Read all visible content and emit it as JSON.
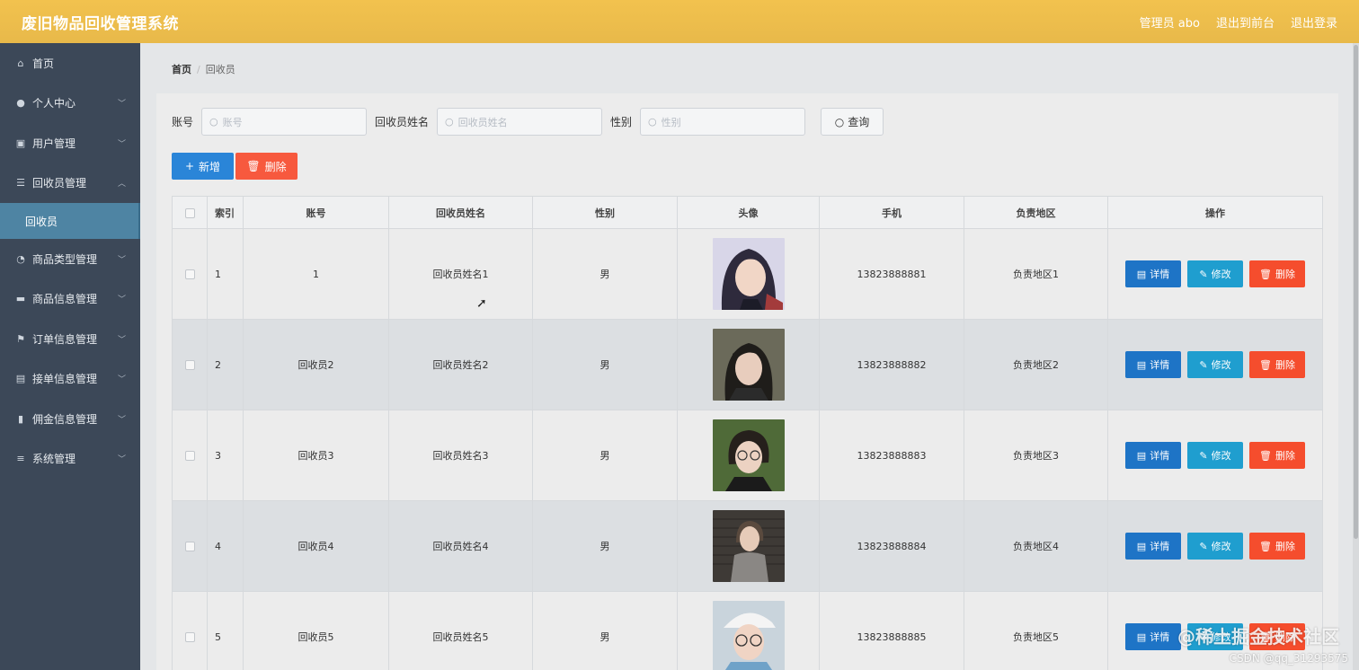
{
  "app": {
    "title": "废旧物品回收管理系统"
  },
  "topnav": {
    "admin": "管理员 abo",
    "exit_front": "退出到前台",
    "logout": "退出登录"
  },
  "sidebar": {
    "items": [
      {
        "label": "首页",
        "icon": "home-icon",
        "glyph": "⌂",
        "has_arrow": false
      },
      {
        "label": "个人中心",
        "icon": "user-icon",
        "glyph": "●",
        "has_arrow": true,
        "arrow": "﹀"
      },
      {
        "label": "用户管理",
        "icon": "clipboard-icon",
        "glyph": "▣",
        "has_arrow": true,
        "arrow": "﹀"
      },
      {
        "label": "回收员管理",
        "icon": "sliders-icon",
        "glyph": "☰",
        "has_arrow": true,
        "arrow": "︿"
      },
      {
        "label": "商品类型管理",
        "icon": "dashboard-icon",
        "glyph": "◔",
        "has_arrow": true,
        "arrow": "﹀"
      },
      {
        "label": "商品信息管理",
        "icon": "stamp-icon",
        "glyph": "▬",
        "has_arrow": true,
        "arrow": "﹀"
      },
      {
        "label": "订单信息管理",
        "icon": "flag-icon",
        "glyph": "⚑",
        "has_arrow": true,
        "arrow": "﹀"
      },
      {
        "label": "接单信息管理",
        "icon": "message-icon",
        "glyph": "▤",
        "has_arrow": true,
        "arrow": "﹀"
      },
      {
        "label": "佣金信息管理",
        "icon": "bar-chart-icon",
        "glyph": "▮",
        "has_arrow": true,
        "arrow": "﹀"
      },
      {
        "label": "系统管理",
        "icon": "menu-icon",
        "glyph": "≡",
        "has_arrow": true,
        "arrow": "﹀"
      }
    ],
    "active_sub": "回收员"
  },
  "breadcrumb": {
    "home": "首页",
    "sep": "/",
    "current": "回收员"
  },
  "search": {
    "account_label": "账号",
    "account_placeholder": "账号",
    "name_label": "回收员姓名",
    "name_placeholder": "回收员姓名",
    "gender_label": "性别",
    "gender_placeholder": "性别",
    "query_label": "查询",
    "search_glyph": "○"
  },
  "actions": {
    "add_label": "新增",
    "add_glyph": "+",
    "delete_label": "删除",
    "delete_glyph": "🗑"
  },
  "table": {
    "headers": {
      "index": "索引",
      "account": "账号",
      "name": "回收员姓名",
      "gender": "性别",
      "avatar": "头像",
      "phone": "手机",
      "region": "负责地区",
      "ops": "操作"
    },
    "rows": [
      {
        "index": "1",
        "account": "1",
        "name": "回收员姓名1",
        "gender": "男",
        "phone": "13823888881",
        "region": "负责地区1"
      },
      {
        "index": "2",
        "account": "回收员2",
        "name": "回收员姓名2",
        "gender": "男",
        "phone": "13823888882",
        "region": "负责地区2"
      },
      {
        "index": "3",
        "account": "回收员3",
        "name": "回收员姓名3",
        "gender": "男",
        "phone": "13823888883",
        "region": "负责地区3"
      },
      {
        "index": "4",
        "account": "回收员4",
        "name": "回收员姓名4",
        "gender": "男",
        "phone": "13823888884",
        "region": "负责地区4"
      },
      {
        "index": "5",
        "account": "回收员5",
        "name": "回收员姓名5",
        "gender": "男",
        "phone": "13823888885",
        "region": "负责地区5"
      }
    ],
    "row_actions": {
      "detail": "详情",
      "detail_glyph": "▤",
      "edit": "修改",
      "edit_glyph": "✎",
      "delete": "删除",
      "delete_glyph": "🗑"
    }
  },
  "watermark": {
    "main": "@稀土掘金技术社区",
    "sub": "CSDN @qq_31293575"
  }
}
